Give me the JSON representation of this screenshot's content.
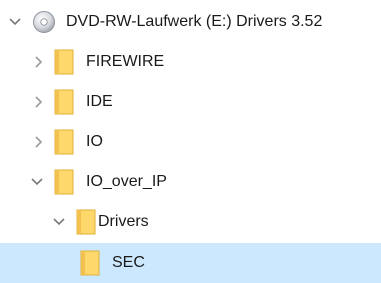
{
  "tree": {
    "items": [
      {
        "label": "DVD-RW-Laufwerk (E:) Drivers 3.52",
        "icon": "dvd-drive-icon",
        "expander": "chevron-down-icon",
        "expanded": true,
        "level": 0
      },
      {
        "label": "FIREWIRE",
        "icon": "folder-icon",
        "expander": "chevron-right-icon",
        "expanded": false,
        "level": 1
      },
      {
        "label": "IDE",
        "icon": "folder-icon",
        "expander": "chevron-right-icon",
        "expanded": false,
        "level": 1
      },
      {
        "label": "IO",
        "icon": "folder-icon",
        "expander": "chevron-right-icon",
        "expanded": false,
        "level": 1
      },
      {
        "label": "IO_over_IP",
        "icon": "folder-icon",
        "expander": "chevron-down-icon",
        "expanded": true,
        "level": 1
      },
      {
        "label": "Drivers",
        "icon": "folder-icon",
        "expander": "chevron-down-icon",
        "expanded": true,
        "level": 2
      },
      {
        "label": "SEC",
        "icon": "folder-icon",
        "expander": "none",
        "expanded": false,
        "level": 3,
        "selected": true
      }
    ]
  },
  "colors": {
    "selection": "#cce8ff",
    "folder_fill": "#ffd86b",
    "folder_edge": "#e0b03a",
    "chevron": "#7a7a7a",
    "text": "#1a1a1a"
  }
}
